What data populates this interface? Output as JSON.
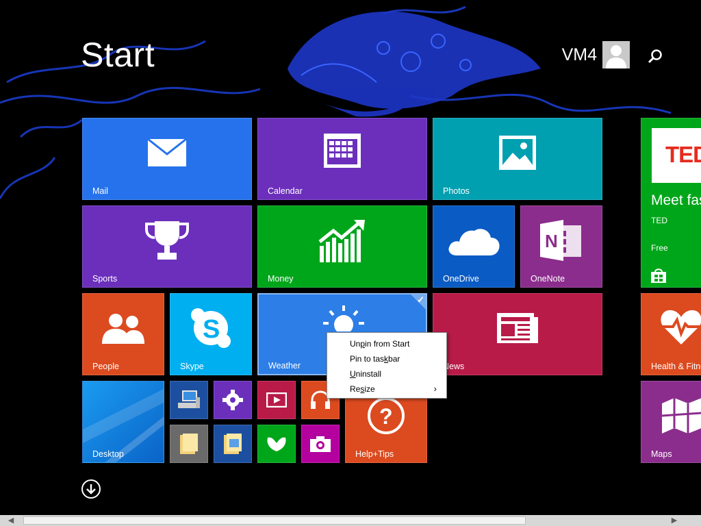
{
  "header": {
    "title": "Start",
    "username": "VM4"
  },
  "tiles": {
    "mail": "Mail",
    "calendar": "Calendar",
    "photos": "Photos",
    "sports": "Sports",
    "money": "Money",
    "onedrive": "OneDrive",
    "onenote": "OneNote",
    "people": "People",
    "skype": "Skype",
    "weather": "Weather",
    "news": "News",
    "desktop": "Desktop",
    "helptips": "Help+Tips",
    "health": "Health & Fitness",
    "maps": "Maps"
  },
  "ted_tile": {
    "logo": "TED",
    "headline": "Meet fascinating",
    "app": "TED",
    "price": "Free"
  },
  "context_menu": {
    "unpin_pre": "Un",
    "unpin_u": "p",
    "unpin_post": "in from Start",
    "pin_pre": "Pin to tas",
    "pin_u": "k",
    "pin_post": "bar",
    "uninstall_u": "U",
    "uninstall_post": "ninstall",
    "resize_pre": "Re",
    "resize_u": "s",
    "resize_post": "ize",
    "resize_arrow": "›"
  },
  "scrollbar": {
    "left_arrow": "◀",
    "right_arrow": "▶"
  },
  "colors": {
    "mail": "#2672ec",
    "calendar": "#6b2fbc",
    "photos": "#00a0b1",
    "sports": "#6b2fbc",
    "money": "#00a61a",
    "onedrive": "#0a5bc4",
    "onenote": "#8b2d8c",
    "people": "#dc4a1f",
    "skype": "#00aff0",
    "weather": "#2d7ee6",
    "news": "#b81b48",
    "desktop": "#1b8ce0",
    "helptips": "#dc4a1f",
    "ted": "#00a61a",
    "health": "#dc4a1f",
    "maps": "#8b2d8c"
  }
}
